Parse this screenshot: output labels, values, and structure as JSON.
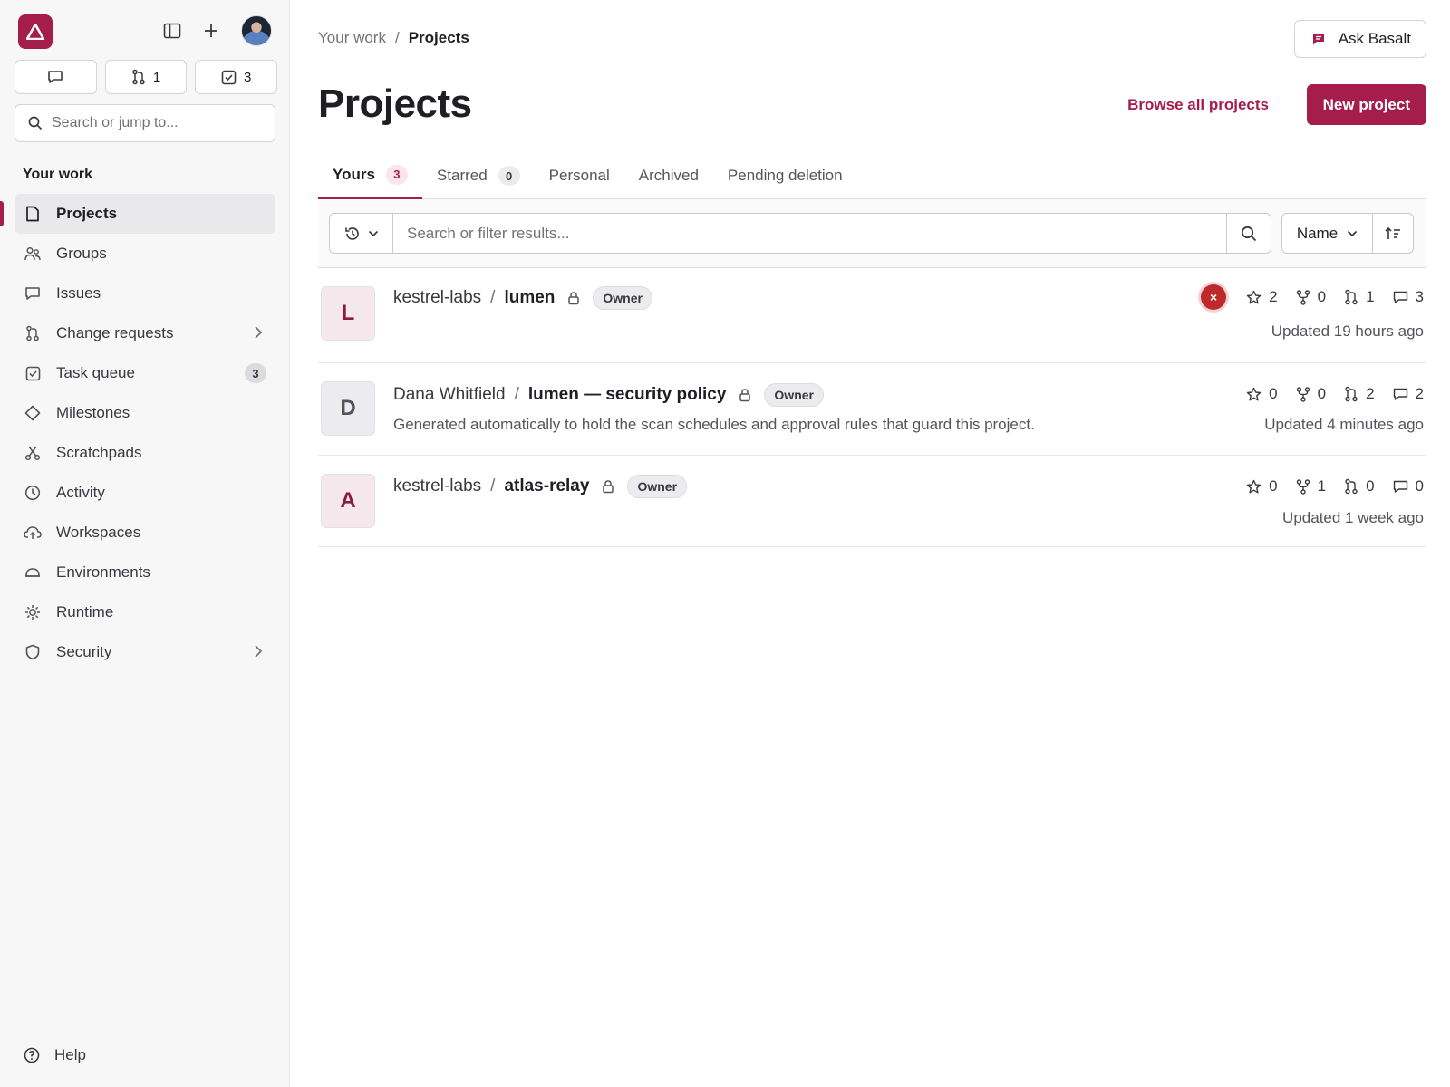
{
  "sidebar": {
    "counts": {
      "change_requests": "1",
      "tasks": "3"
    },
    "search_placeholder": "Search or jump to...",
    "section_title": "Your work",
    "items": [
      {
        "label": "Projects",
        "icon": "project-icon"
      },
      {
        "label": "Groups",
        "icon": "groups-icon"
      },
      {
        "label": "Issues",
        "icon": "issues-icon"
      },
      {
        "label": "Change requests",
        "icon": "merge-icon"
      },
      {
        "label": "Task queue",
        "icon": "todo-icon",
        "badge": "3"
      },
      {
        "label": "Milestones",
        "icon": "milestone-icon"
      },
      {
        "label": "Scratchpads",
        "icon": "snippet-icon"
      },
      {
        "label": "Activity",
        "icon": "history-icon"
      },
      {
        "label": "Workspaces",
        "icon": "cloud-icon"
      },
      {
        "label": "Environments",
        "icon": "environment-icon"
      },
      {
        "label": "Runtime",
        "icon": "runtime-icon"
      },
      {
        "label": "Security",
        "icon": "shield-icon"
      }
    ],
    "help_label": "Help"
  },
  "header": {
    "breadcrumb_root": "Your work",
    "breadcrumb_sep": "/",
    "breadcrumb_current": "Projects",
    "ask_label": "Ask Basalt",
    "title": "Projects",
    "browse_label": "Browse all projects",
    "new_label": "New project"
  },
  "tabs": [
    {
      "label": "Yours",
      "count": "3"
    },
    {
      "label": "Starred",
      "count": "0"
    },
    {
      "label": "Personal"
    },
    {
      "label": "Archived"
    },
    {
      "label": "Pending deletion"
    }
  ],
  "filter": {
    "placeholder": "Search or filter results...",
    "sort_label": "Name"
  },
  "projects": [
    {
      "avatar": "L",
      "namespace": "kestrel-labs",
      "sep": "/",
      "name": "lumen",
      "role": "Owner",
      "description": "",
      "pipeline": "×",
      "stars": "2",
      "forks": "0",
      "mrs": "1",
      "issues": "3",
      "updated": "Updated 19 hours ago"
    },
    {
      "avatar": "D",
      "namespace": "Dana Whitfield",
      "sep": "/",
      "name": "lumen — security policy",
      "role": "Owner",
      "description": "Generated automatically to hold the scan schedules and approval rules that guard this project.",
      "stars": "0",
      "forks": "0",
      "mrs": "2",
      "issues": "2",
      "updated": "Updated 4 minutes ago"
    },
    {
      "avatar": "A",
      "namespace": "kestrel-labs",
      "sep": "/",
      "name": "atlas-relay",
      "role": "Owner",
      "description": "",
      "stars": "0",
      "forks": "1",
      "mrs": "0",
      "issues": "0",
      "updated": "Updated 1 week ago"
    }
  ],
  "colors": {
    "brand": "#a51d4b",
    "avatar_l_bg": "#f5e8ec",
    "avatar_d_bg": "#ececef",
    "avatar_a_bg": "#f5e8ec",
    "avatar_l_fg": "#8c1a3f",
    "avatar_d_fg": "#55535b",
    "avatar_a_fg": "#8c1a3f",
    "pipeline_failed": "#c0292a"
  }
}
